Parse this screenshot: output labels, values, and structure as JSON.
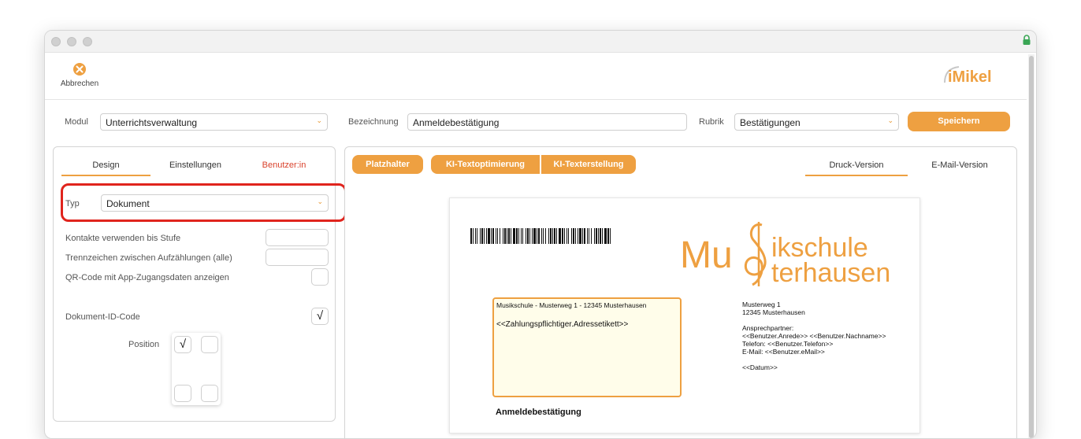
{
  "toolbar": {
    "cancel_label": "Abbrechen",
    "logo_text": "iMikel"
  },
  "form": {
    "modul_label": "Modul",
    "modul_value": "Unterrichtsverwaltung",
    "bezeichnung_label": "Bezeichnung",
    "bezeichnung_value": "Anmeldebestätigung",
    "rubrik_label": "Rubrik",
    "rubrik_value": "Bestätigungen",
    "save_label": "Speichern"
  },
  "left_tabs": [
    "Design",
    "Einstellungen",
    "Benutzer:in"
  ],
  "design": {
    "typ_label": "Typ",
    "typ_value": "Dokument",
    "kontakte_label": "Kontakte verwenden bis Stufe",
    "trennzeichen_label": "Trennzeichen zwischen Aufzählungen (alle)",
    "qr_label": "QR-Code mit App-Zugangsdaten anzeigen",
    "docid_label": "Dokument-ID-Code",
    "docid_checked": true,
    "position_label": "Position",
    "check_glyph": "√",
    "position_top_left_checked": true
  },
  "right_buttons": {
    "platzhalter": "Platzhalter",
    "ki_opt": "KI-Textoptimierung",
    "ki_create": "KI-Texterstellung"
  },
  "right_tabs": [
    "Druck-Version",
    "E-Mail-Version"
  ],
  "preview": {
    "logo_line1_a": "Mu",
    "logo_line1_b": "ikschule",
    "logo_line2": "terhausen",
    "sender_line": "Musikschule - Musterweg 1 - 12345 Musterhausen",
    "address_placeholder": "<<Zahlungspflichtiger.Adressetikett>>",
    "street": "Musterweg 1",
    "city": "12345 Musterhausen",
    "contact_label": "Ansprechpartner:",
    "contact_name": "<<Benutzer.Anrede>> <<Benutzer.Nachname>>",
    "phone": "Telefon: <<Benutzer.Telefon>>",
    "email": "E-Mail: <<Benutzer.eMail>>",
    "date": "<<Datum>>",
    "heading": "Anmeldebestätigung"
  },
  "colors": {
    "accent": "#eea041",
    "highlight": "#e0241d",
    "user_tab": "#d9412b"
  }
}
